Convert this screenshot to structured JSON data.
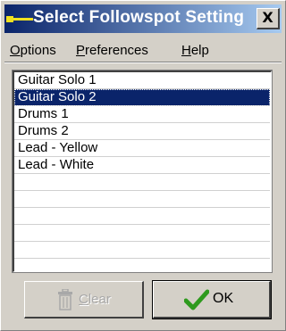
{
  "window": {
    "title": "Select Followspot Setting",
    "close_glyph": "X",
    "title_gradient": [
      "#0a246a",
      "#a6caf0"
    ]
  },
  "menu": {
    "items": [
      {
        "label_first": "O",
        "label_rest": "ptions"
      },
      {
        "label_first": "P",
        "label_rest": "references"
      },
      {
        "label_first": "H",
        "label_rest": "elp"
      }
    ]
  },
  "list": {
    "items": [
      {
        "label": "Guitar Solo 1",
        "selected": false
      },
      {
        "label": "Guitar Solo 2",
        "selected": true
      },
      {
        "label": "Drums 1",
        "selected": false
      },
      {
        "label": "Drums 2",
        "selected": false
      },
      {
        "label": "Lead - Yellow",
        "selected": false
      },
      {
        "label": "Lead - White",
        "selected": false
      }
    ],
    "selected_color": "#0a246a"
  },
  "buttons": {
    "clear": {
      "label_first": "C",
      "label_rest": "lear",
      "icon": "trash-icon",
      "enabled": false
    },
    "ok": {
      "label": "OK",
      "icon": "checkmark-icon",
      "check_color": "#2e9a1e"
    }
  }
}
